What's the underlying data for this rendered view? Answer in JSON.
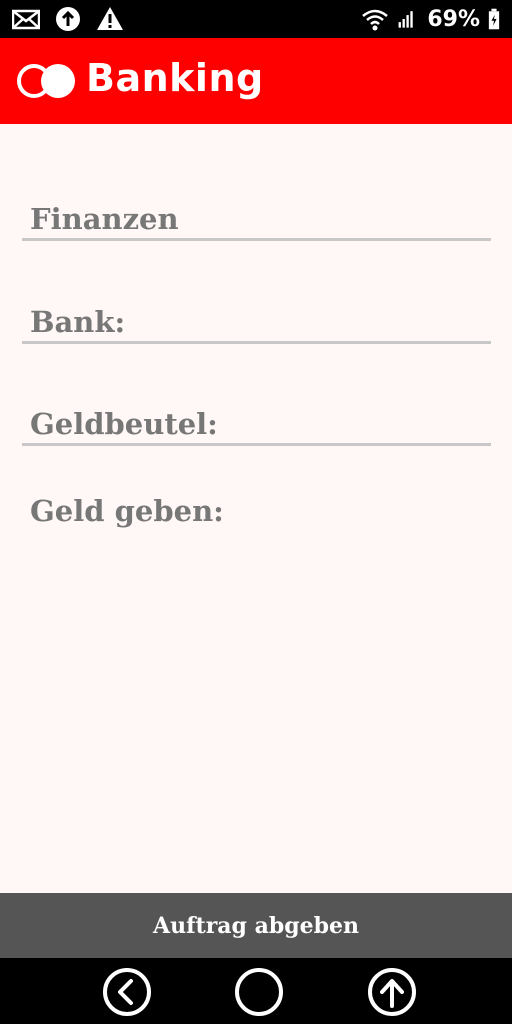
{
  "status_bar": {
    "battery_percent": "69%",
    "icons": [
      "mail-icon",
      "upload-icon",
      "warning-icon",
      "wifi-icon",
      "signal-icon",
      "battery-icon"
    ]
  },
  "app_bar": {
    "title": "Banking",
    "background_color": "#ff0000"
  },
  "form": {
    "fields": [
      {
        "label": "Finanzen"
      },
      {
        "label": "Bank:"
      },
      {
        "label": "Geldbeutel:"
      }
    ],
    "give_money_label": "Geld geben:"
  },
  "submit_button": {
    "label": "Auftrag abgeben",
    "background_color": "#555555"
  },
  "nav_bar": {
    "icons": [
      "back-icon",
      "home-icon",
      "up-icon"
    ]
  }
}
